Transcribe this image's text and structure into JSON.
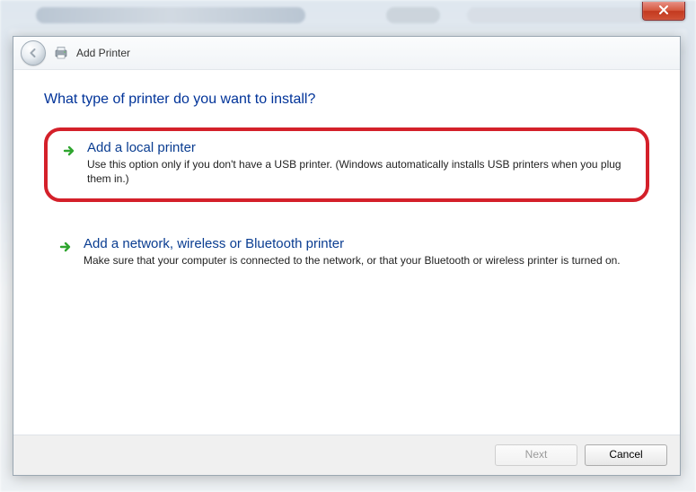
{
  "window": {
    "close_tooltip": "Close"
  },
  "wizard": {
    "title": "Add Printer",
    "question": "What type of printer do you want to install?",
    "options": [
      {
        "heading": "Add a local printer",
        "description": "Use this option only if you don't have a USB printer. (Windows automatically installs USB printers when you plug them in.)",
        "highlighted": true
      },
      {
        "heading": "Add a network, wireless or Bluetooth printer",
        "description": "Make sure that your computer is connected to the network, or that your Bluetooth or wireless printer is turned on.",
        "highlighted": false
      }
    ],
    "buttons": {
      "next": "Next",
      "cancel": "Cancel"
    }
  }
}
